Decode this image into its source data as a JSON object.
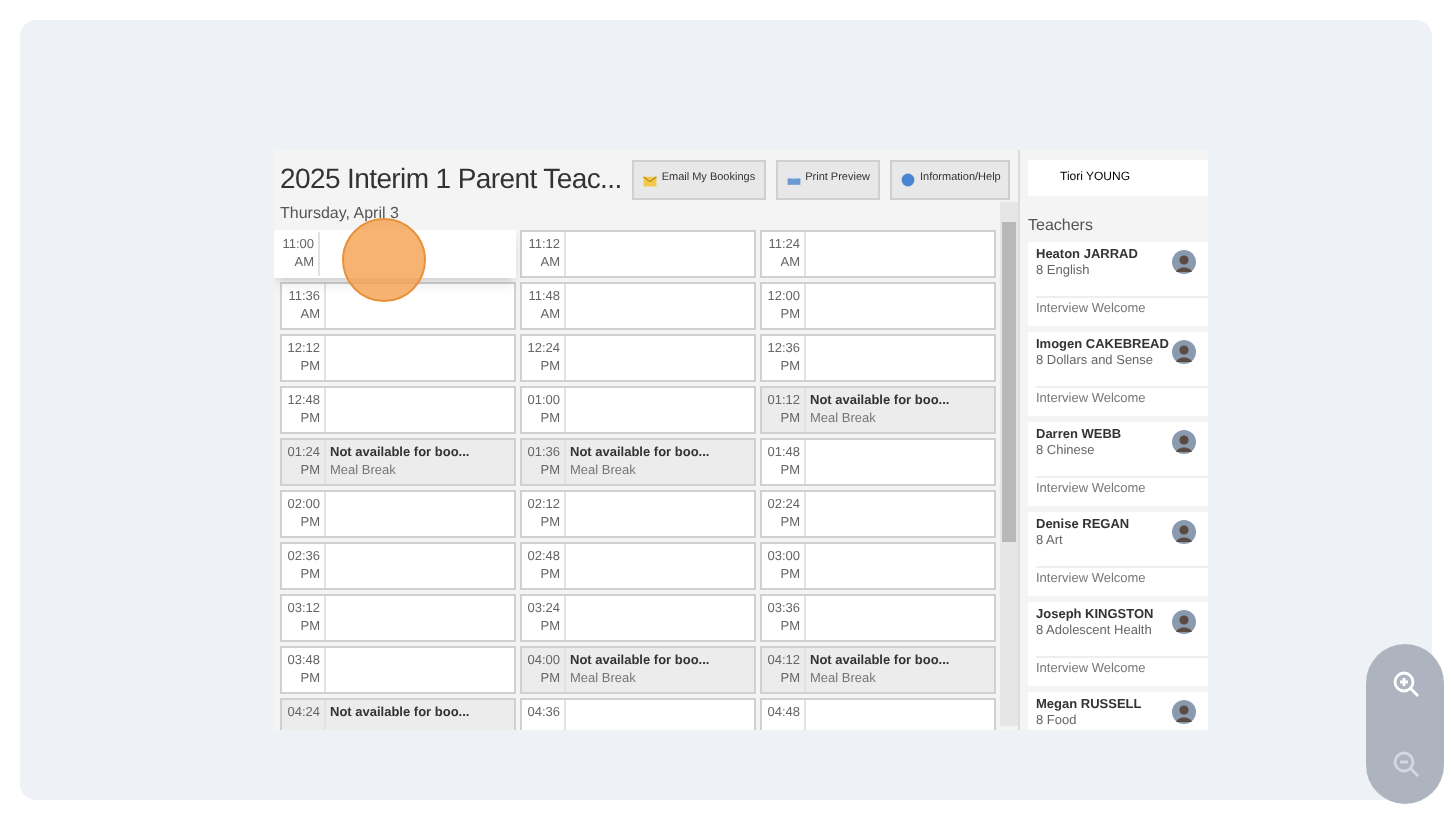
{
  "header": {
    "title": "2025 Interim 1 Parent Teac...",
    "buttons": [
      {
        "label": "Email My Bookings",
        "kind": "email"
      },
      {
        "label": "Print Preview",
        "kind": "print"
      },
      {
        "label": "Information/Help",
        "kind": "help"
      }
    ],
    "student": "Tiori YOUNG"
  },
  "date": "Thursday, April 3",
  "slots": [
    [
      {
        "time": "11:00",
        "period": "AM",
        "kind": "open",
        "selected": true
      },
      {
        "time": "11:12",
        "period": "AM",
        "kind": "open",
        "selected": false
      },
      {
        "time": "11:24",
        "period": "AM",
        "kind": "open",
        "selected": false
      }
    ],
    [
      {
        "time": "11:36",
        "period": "AM",
        "kind": "open",
        "selected": false
      },
      {
        "time": "11:48",
        "period": "AM",
        "kind": "open",
        "selected": false
      },
      {
        "time": "12:00",
        "period": "PM",
        "kind": "open",
        "selected": false
      }
    ],
    [
      {
        "time": "12:12",
        "period": "PM",
        "kind": "open",
        "selected": false
      },
      {
        "time": "12:24",
        "period": "PM",
        "kind": "open",
        "selected": false
      },
      {
        "time": "12:36",
        "period": "PM",
        "kind": "open",
        "selected": false
      }
    ],
    [
      {
        "time": "12:48",
        "period": "PM",
        "kind": "open",
        "selected": false
      },
      {
        "time": "01:00",
        "period": "PM",
        "kind": "open",
        "selected": false
      },
      {
        "time": "01:12",
        "period": "PM",
        "kind": "unavailable",
        "title": "Not available for boo...",
        "note": "Meal Break",
        "selected": false
      }
    ],
    [
      {
        "time": "01:24",
        "period": "PM",
        "kind": "unavailable",
        "title": "Not available for boo...",
        "note": "Meal Break",
        "selected": false
      },
      {
        "time": "01:36",
        "period": "PM",
        "kind": "unavailable",
        "title": "Not available for boo...",
        "note": "Meal Break",
        "selected": false
      },
      {
        "time": "01:48",
        "period": "PM",
        "kind": "open",
        "selected": false
      }
    ],
    [
      {
        "time": "02:00",
        "period": "PM",
        "kind": "open",
        "selected": false
      },
      {
        "time": "02:12",
        "period": "PM",
        "kind": "open",
        "selected": false
      },
      {
        "time": "02:24",
        "period": "PM",
        "kind": "open",
        "selected": false
      }
    ],
    [
      {
        "time": "02:36",
        "period": "PM",
        "kind": "open",
        "selected": false
      },
      {
        "time": "02:48",
        "period": "PM",
        "kind": "open",
        "selected": false
      },
      {
        "time": "03:00",
        "period": "PM",
        "kind": "open",
        "selected": false
      }
    ],
    [
      {
        "time": "03:12",
        "period": "PM",
        "kind": "open",
        "selected": false
      },
      {
        "time": "03:24",
        "period": "PM",
        "kind": "open",
        "selected": false
      },
      {
        "time": "03:36",
        "period": "PM",
        "kind": "open",
        "selected": false
      }
    ],
    [
      {
        "time": "03:48",
        "period": "PM",
        "kind": "open",
        "selected": false
      },
      {
        "time": "04:00",
        "period": "PM",
        "kind": "unavailable",
        "title": "Not available for boo...",
        "note": "Meal Break",
        "selected": false
      },
      {
        "time": "04:12",
        "period": "PM",
        "kind": "unavailable",
        "title": "Not available for boo...",
        "note": "Meal Break",
        "selected": false
      }
    ],
    [
      {
        "time": "04:24",
        "kind": "unavailable",
        "title": "Not available for boo...",
        "selected": false
      },
      {
        "time": "04:36",
        "kind": "open",
        "selected": false
      },
      {
        "time": "04:48",
        "kind": "open",
        "selected": false
      }
    ]
  ],
  "teachers_title": "Teachers",
  "teachers": [
    {
      "name": "Heaton JARRAD",
      "subject": "8 English",
      "status": "Interview Welcome"
    },
    {
      "name": "Imogen CAKEBREAD",
      "subject": "8 Dollars and Sense",
      "status": "Interview Welcome"
    },
    {
      "name": "Darren WEBB",
      "subject": "8 Chinese",
      "status": "Interview Welcome"
    },
    {
      "name": "Denise REGAN",
      "subject": "8 Art",
      "status": "Interview Welcome"
    },
    {
      "name": "Joseph KINGSTON",
      "subject": "8 Adolescent Health",
      "status": "Interview Welcome"
    },
    {
      "name": "Megan RUSSELL",
      "subject": "8 Food"
    }
  ]
}
